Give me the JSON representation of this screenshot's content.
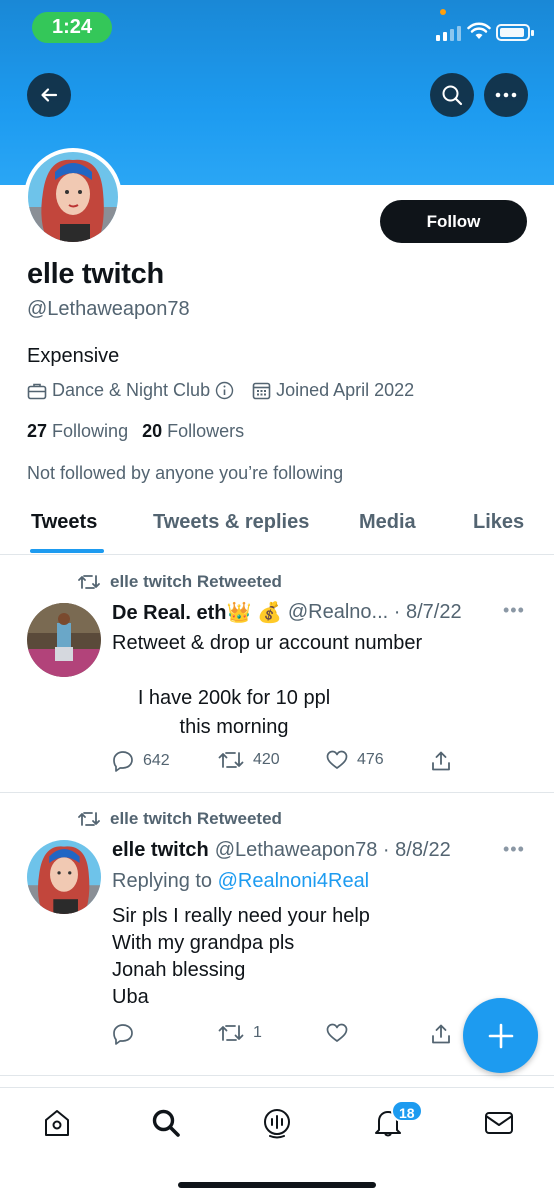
{
  "status_bar": {
    "time": "1:24"
  },
  "profile": {
    "name": "elle twitch",
    "handle": "@Lethaweapon78",
    "bio": "Expensive",
    "category": "Dance & Night Club",
    "joined": "Joined April 2022",
    "following_count": "27",
    "following_label": "Following",
    "followers_count": "20",
    "followers_label": "Followers",
    "not_followed_text": "Not followed by anyone you’re following",
    "follow_button_label": "Follow"
  },
  "tabs": [
    {
      "label": "Tweets",
      "active": true
    },
    {
      "label": "Tweets & replies",
      "active": false
    },
    {
      "label": "Media",
      "active": false
    },
    {
      "label": "Likes",
      "active": false
    }
  ],
  "tweets": [
    {
      "retweeted_by": "elle twitch Retweeted",
      "display_name": "De Real. eth👑 💰",
      "handle_date": "@Realno... · 8/7/22",
      "text_lines": [
        "Retweet & drop ur account number"
      ],
      "center_lines": [
        "I have 200k for 10 ppl",
        "this morning"
      ],
      "replies": "642",
      "retweets": "420",
      "likes": "476"
    },
    {
      "retweeted_by": "elle twitch Retweeted",
      "display_name": "elle twitch",
      "handle_date": "@Lethaweapon78 · 8/8/22",
      "replying_prefix": "Replying to",
      "replying_handle": "@Realnoni4Real",
      "text_lines": [
        "Sir pls I really need your help",
        "With my grandpa pls",
        "Jonah blessing",
        "Uba"
      ],
      "replies": "",
      "retweets": "1",
      "likes": ""
    }
  ],
  "bottom_nav": {
    "notifications_badge": "18"
  },
  "colors": {
    "accent": "#1d9bf0",
    "text": "#0f1419",
    "muted": "#536471"
  }
}
